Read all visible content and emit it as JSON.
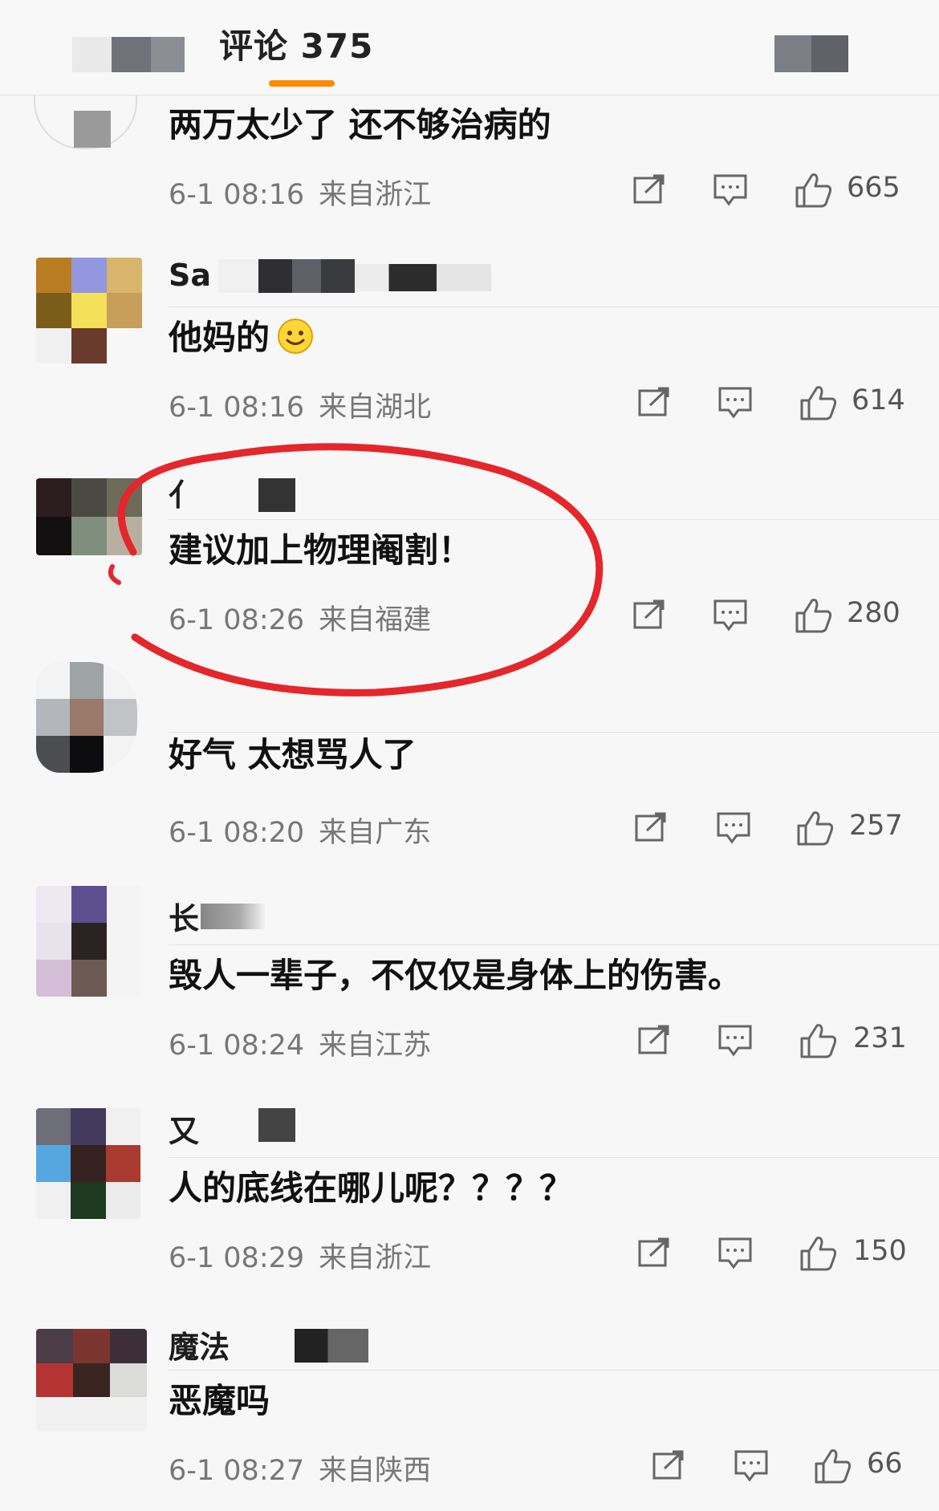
{
  "header": {
    "tab_title": "评论 375"
  },
  "comments": [
    {
      "username": "",
      "text": "两万太少了 还不够治病的",
      "time": "6-1 08:16",
      "location": "来自浙江",
      "likes": "665"
    },
    {
      "username": "Sa",
      "text": "他妈的",
      "time": "6-1 08:16",
      "location": "来自湖北",
      "likes": "614"
    },
    {
      "username": "亻",
      "text": "建议加上物理阉割！",
      "time": "6-1 08:26",
      "location": "来自福建",
      "likes": "280"
    },
    {
      "username": "",
      "text": "好气 太想骂人了",
      "time": "6-1 08:20",
      "location": "来自广东",
      "likes": "257"
    },
    {
      "username": "长",
      "text": "毁人一辈子，不仅仅是身体上的伤害。",
      "time": "6-1 08:24",
      "location": "来自江苏",
      "likes": "231"
    },
    {
      "username": "又",
      "text": "人的底线在哪儿呢？？？？",
      "time": "6-1 08:29",
      "location": "来自浙江",
      "likes": "150"
    },
    {
      "username": "魔法",
      "text": "恶魔吗",
      "time": "6-1 08:27",
      "location": "来自陕西",
      "likes": "66"
    }
  ],
  "colors": {
    "accent": "#ff8a00",
    "annotation": "#e5262b"
  },
  "icons": [
    "share-icon",
    "reply-icon",
    "like-icon",
    "smiley-icon"
  ]
}
